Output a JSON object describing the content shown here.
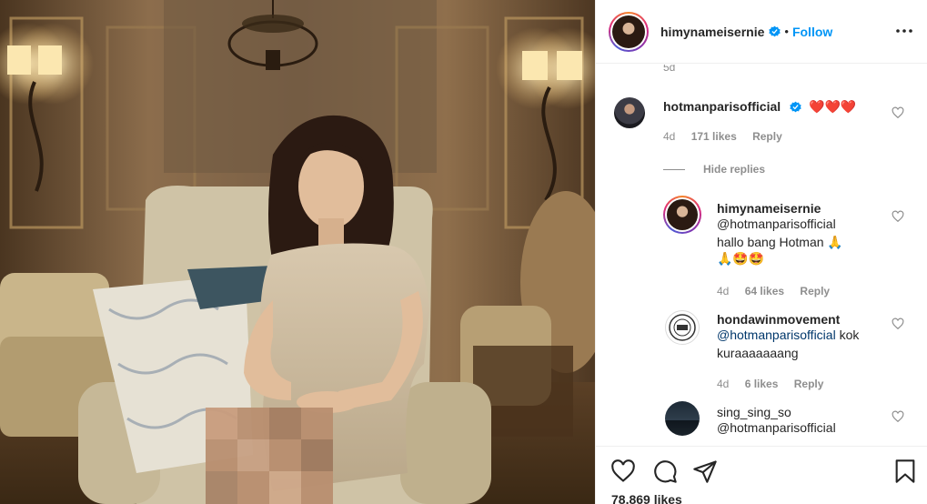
{
  "post": {
    "username": "himynameisernie",
    "follow_label": "Follow",
    "separator": "•",
    "prev_time": "5d",
    "likes": "78,869 likes"
  },
  "comments": [
    {
      "username": "hotmanparisofficial",
      "text": "❤️❤️❤️",
      "time": "4d",
      "likes": "171 likes",
      "reply_label": "Reply",
      "verified": true
    }
  ],
  "hide_replies_label": "Hide replies",
  "replies": [
    {
      "username": "himynameisernie",
      "mention": "@hotmanparisofficial",
      "line2": "hallo bang Hotman 🙏",
      "line3": "🙏🤩🤩",
      "time": "4d",
      "likes": "64 likes",
      "reply_label": "Reply"
    },
    {
      "username": "hondawinmovement",
      "mention": "@hotmanparisofficial",
      "line2": "kok",
      "line3": "kuraaaaaaang",
      "time": "4d",
      "likes": "6 likes",
      "reply_label": "Reply"
    },
    {
      "username": "sing_sing_so",
      "mention": "@hotmanparisofficial"
    }
  ],
  "icons": {
    "verified": "verified-badge-icon",
    "more": "more-options-icon",
    "like": "heart-icon",
    "comment": "comment-icon",
    "share": "share-icon",
    "save": "bookmark-icon"
  },
  "colors": {
    "accent": "#0095f6",
    "mention": "#00376b",
    "muted": "#8e8e8e",
    "border": "#efefef"
  }
}
